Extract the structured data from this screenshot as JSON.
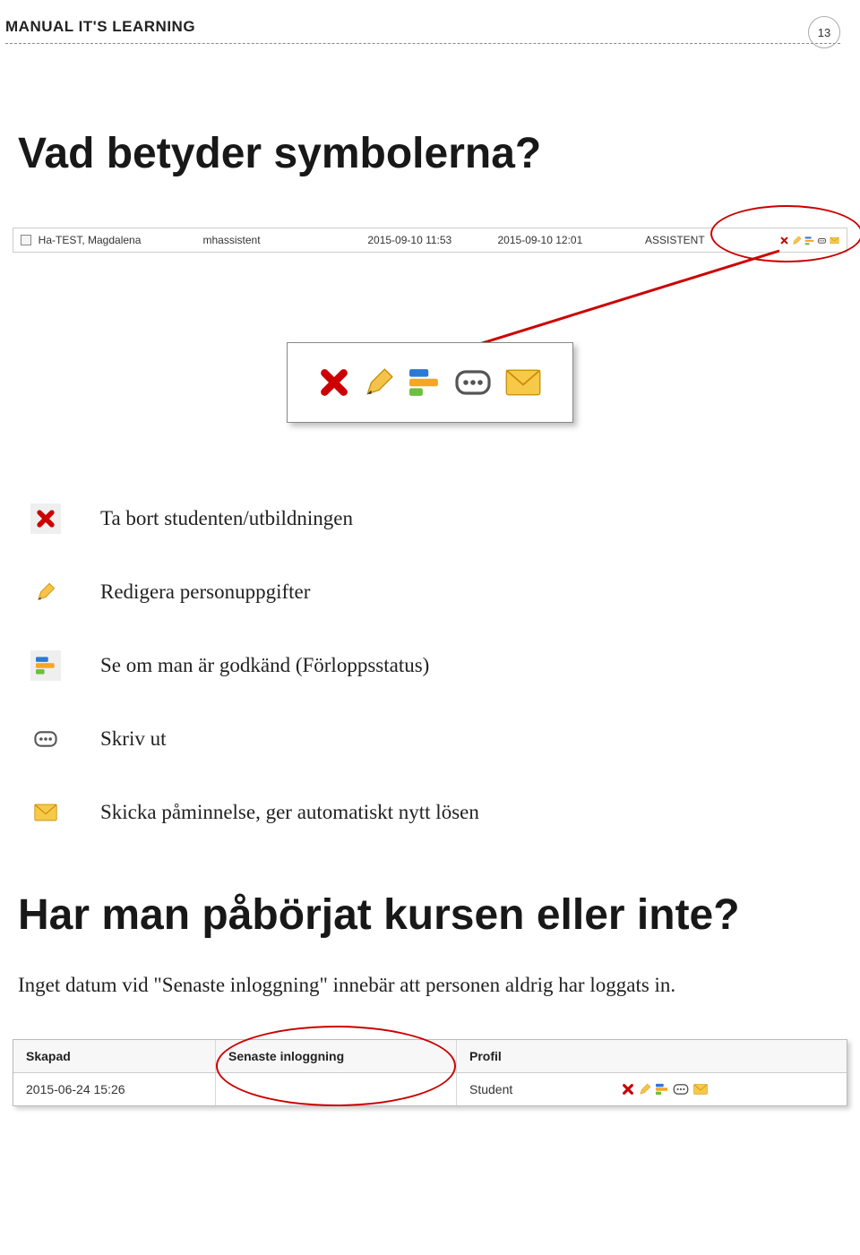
{
  "header": {
    "title": "MANUAL IT'S LEARNING",
    "page_number": "13"
  },
  "heading1": "Vad betyder symbolerna?",
  "table_row": {
    "name": "Ha-TEST, Magdalena",
    "user": "mhassistent",
    "dt1": "2015-09-10 11:53",
    "dt2": "2015-09-10 12:01",
    "role": "ASSISTENT"
  },
  "legend": [
    {
      "icon": "delete",
      "text": "Ta bort studenten/utbildningen"
    },
    {
      "icon": "edit",
      "text": "Redigera personuppgifter"
    },
    {
      "icon": "status",
      "text": "Se om man är godkänd (Förloppsstatus)"
    },
    {
      "icon": "print",
      "text": "Skriv ut"
    },
    {
      "icon": "mail",
      "text": "Skicka påminnelse, ger automatiskt nytt lösen"
    }
  ],
  "heading2": "Har man påbörjat kursen eller inte?",
  "para2": "Inget datum vid \"Senaste inloggning\" innebär att personen aldrig har loggats in.",
  "bottom_table": {
    "headers": {
      "c1": "Skapad",
      "c2": "Senaste inloggning",
      "c3": "Profil"
    },
    "row": {
      "c1": "2015-06-24 15:26",
      "c2": "",
      "c3": "Student"
    }
  }
}
